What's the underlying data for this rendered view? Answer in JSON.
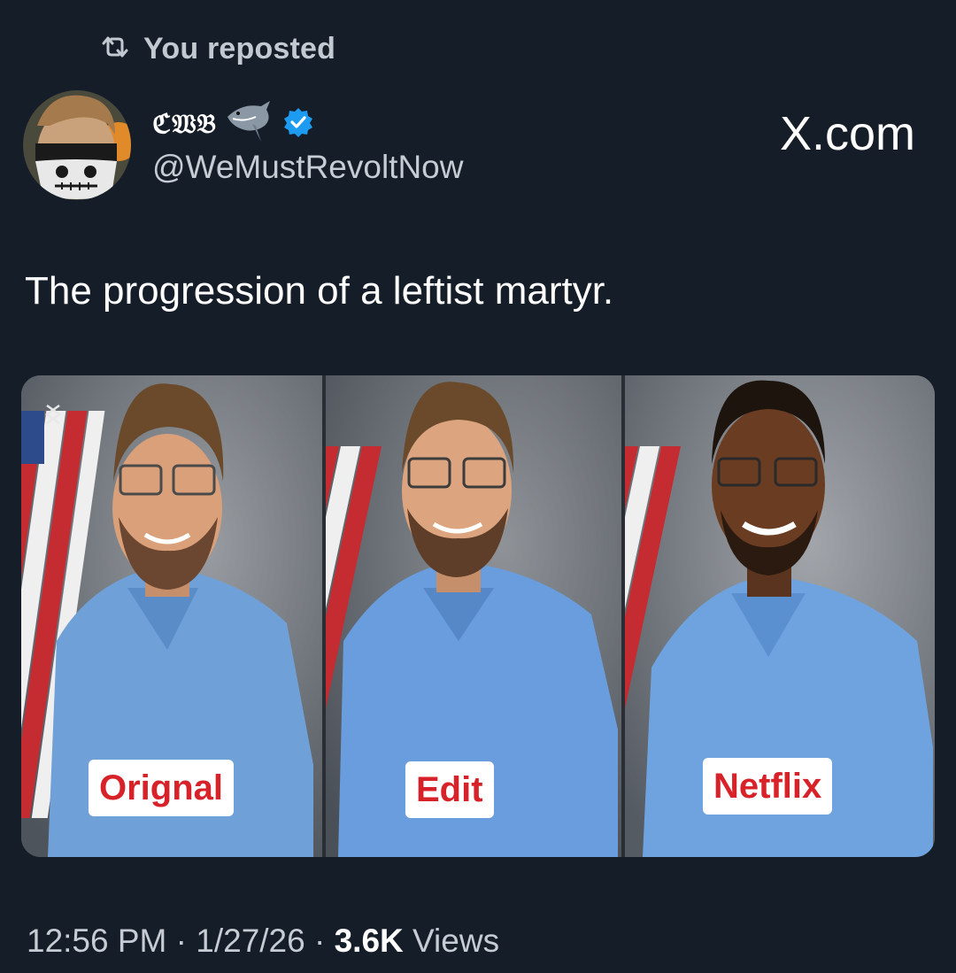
{
  "repost": {
    "icon": "repost-icon",
    "label": "You reposted"
  },
  "author": {
    "display_name": "ℭ𝔚𝔅",
    "handle": "@WeMustRevoltNow",
    "verified": true,
    "badge_emoji": "shark-icon"
  },
  "watermark": "X.com",
  "tweet": {
    "text": "The progression of a leftist martyr."
  },
  "media": {
    "panels": [
      {
        "label": "Orignal"
      },
      {
        "label": "Edit"
      },
      {
        "label": "Netflix"
      }
    ],
    "corner_logo": "capcut-logo-icon"
  },
  "meta": {
    "time": "12:56 PM",
    "date": "1/27/26",
    "views": "3.6K",
    "views_label": "Views"
  },
  "colors": {
    "background": "#151d28",
    "verified": "#1d9bf0",
    "tag_text": "#d8222a",
    "scrubs": "#6fa0d8"
  }
}
